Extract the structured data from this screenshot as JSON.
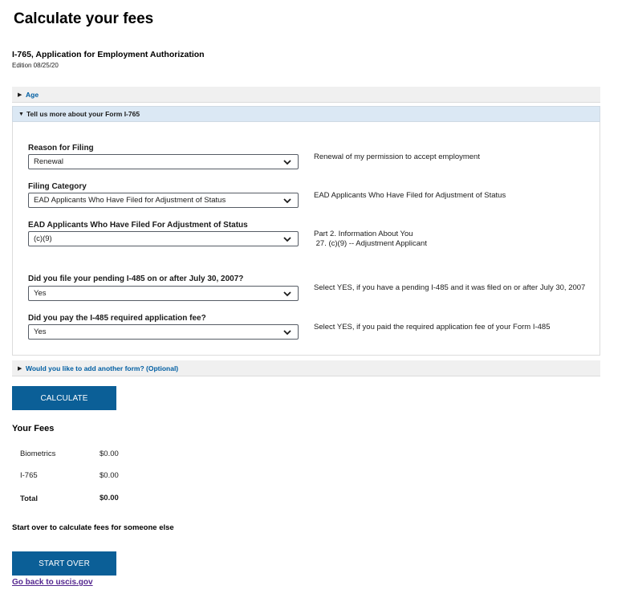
{
  "page": {
    "title": "Calculate your fees",
    "form_name": "I-765, Application for Employment Authorization",
    "edition": "Edition 08/25/20"
  },
  "accordions": {
    "age": "Age",
    "more": "Tell us more about your Form I-765",
    "add": "Would you like to add another form? (Optional)"
  },
  "fields": [
    {
      "label": "Reason for Filing",
      "value": "Renewal",
      "description": "Renewal of my permission to accept employment"
    },
    {
      "label": "Filing Category",
      "value": "EAD Applicants Who Have Filed for Adjustment of Status",
      "description": "EAD Applicants Who Have Filed for Adjustment of Status"
    },
    {
      "label": "EAD Applicants Who Have Filed For Adjustment of Status",
      "value": "(c)(9)",
      "description_line1": "Part 2. Information About You",
      "description_line2": " 27. (c)(9) -- Adjustment Applicant"
    },
    {
      "label": "Did you file your pending I-485 on or after July 30, 2007?",
      "value": "Yes",
      "description": "Select YES, if you have a pending I-485 and it was filed on or after July 30, 2007"
    },
    {
      "label": "Did you pay the I-485 required application fee?",
      "value": "Yes",
      "description": "Select YES, if you paid the required application fee of your Form I-485"
    }
  ],
  "buttons": {
    "calculate": "CALCULATE",
    "start_over": "START OVER"
  },
  "fees": {
    "title": "Your Fees",
    "rows": [
      {
        "name": "Biometrics",
        "amount": "$0.00"
      },
      {
        "name": "I-765",
        "amount": "$0.00"
      }
    ],
    "total_label": "Total",
    "total_amount": "$0.00"
  },
  "start_over_text": "Start over to calculate fees for someone else",
  "back_link": "Go back to uscis.gov",
  "colors": {
    "primary_button": "#0b5f97",
    "link": "#005ea2",
    "visited_link": "#54278f",
    "accordion_active": "#dbe8f4"
  }
}
